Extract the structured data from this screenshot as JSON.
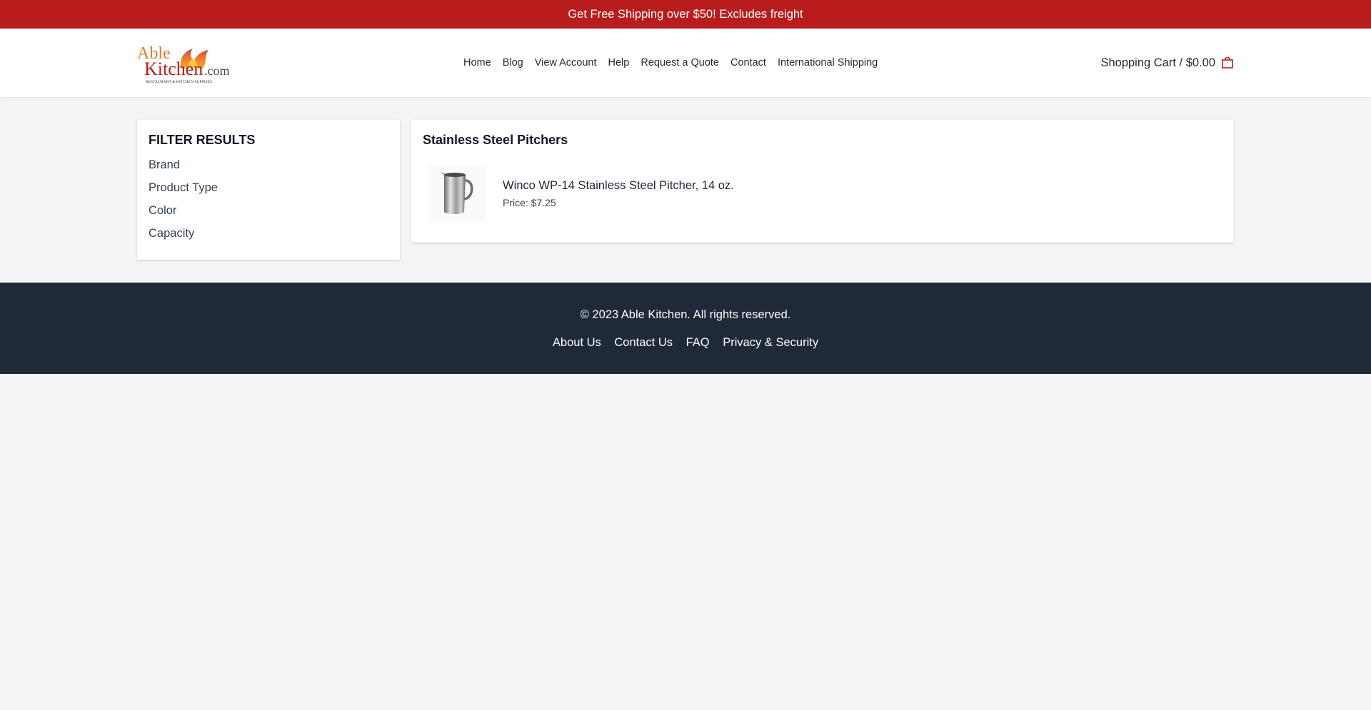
{
  "promo": {
    "text": "Get Free Shipping over $50! Excludes freight"
  },
  "header": {
    "logo": {
      "main": "Able Kitchen",
      "suffix": ".com",
      "tagline": "RESTAURANT & KITCHEN SUPPLIES"
    },
    "nav": [
      "Home",
      "Blog",
      "View Account",
      "Help",
      "Request a Quote",
      "Contact",
      "International Shipping"
    ],
    "cart": {
      "label": "Shopping Cart / $0.00",
      "icon": "shopping-bag-icon"
    }
  },
  "filters": {
    "title": "FILTER RESULTS",
    "items": [
      "Brand",
      "Product Type",
      "Color",
      "Capacity"
    ]
  },
  "products": {
    "category": "Stainless Steel Pitchers",
    "items": [
      {
        "name": "Winco WP-14 Stainless Steel Pitcher, 14 oz.",
        "price": "Price: $7.25",
        "image": "pitcher-image"
      }
    ]
  },
  "footer": {
    "copyright": "© 2023 Able Kitchen. All rights reserved.",
    "links": [
      "About Us",
      "Contact Us",
      "FAQ",
      "Privacy & Security"
    ]
  },
  "colors": {
    "brand_red": "#b91c1c",
    "footer_bg": "#1f2937",
    "page_bg": "#f3f4f6"
  }
}
